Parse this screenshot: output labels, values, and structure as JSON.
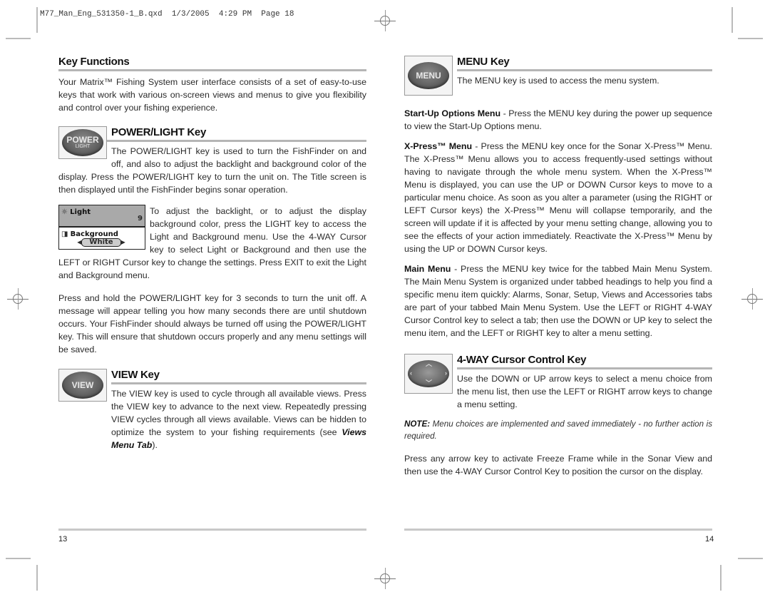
{
  "slug": "M77_Man_Eng_531350-1_B.qxd  1/3/2005  4:29 PM  Page 18",
  "left": {
    "key_functions": {
      "title": "Key Functions",
      "body": "Your Matrix™ Fishing System user interface consists of a set of easy-to-use keys that work with various on-screen views and menus to give you flexibility and control over your fishing experience."
    },
    "power_light": {
      "title": "POWER/LIGHT Key",
      "icon_label_top": "POWER",
      "icon_label_bottom": "LIGHT",
      "body": "The POWER/LIGHT key is used to turn the FishFinder on and off, and also to adjust the backlight and background color of the display. Press the POWER/LIGHT key to turn the unit on. The Title screen is then displayed until the FishFinder begins sonar operation.",
      "lcd": {
        "light_label": "Light",
        "light_value": "9",
        "background_label": "Background",
        "background_value": "White"
      },
      "adjust_body": "To adjust the backlight, or to adjust the display background color, press the LIGHT key to access the Light and Background menu. Use the 4-WAY Cursor key to select Light or Background and then use the LEFT or RIGHT Cursor key to change the settings. Press EXIT to exit the Light and Background menu.",
      "hold_body": "Press and hold the POWER/LIGHT key for 3 seconds to turn the unit off. A message will appear telling you how many seconds there are until shutdown occurs. Your FishFinder should always be turned off using the POWER/LIGHT key. This will ensure that shutdown occurs properly and any menu settings will be saved."
    },
    "view": {
      "title": "VIEW Key",
      "icon_label": "VIEW",
      "body": "The VIEW key is used to cycle through all available views. Press the VIEW key to advance to the next view. Repeatedly pressing VIEW cycles through all views available. Views can be hidden to optimize the system to your fishing requirements (see ",
      "link": "Views Menu Tab",
      "body_end": ")."
    },
    "page_number": "13"
  },
  "right": {
    "menu": {
      "title": "MENU Key",
      "icon_label": "MENU",
      "body": "The MENU key is used to access the menu system."
    },
    "startup": {
      "term": "Start-Up Options Menu",
      "body": " - Press the MENU key during the power up sequence to view the Start-Up Options menu."
    },
    "xpress": {
      "term": "X-Press™ Menu",
      "body": " - Press the MENU key once for the Sonar X-Press™ Menu. The X-Press™ Menu allows you to access frequently-used settings without having to navigate through the whole menu system. When the X-Press™ Menu is displayed, you can use the UP or DOWN Cursor keys to move to a particular menu choice. As soon as you alter a parameter (using the RIGHT or LEFT Cursor keys) the X-Press™ Menu will collapse temporarily, and the screen will update if it is affected by your menu setting change, allowing you to see the effects of your action immediately. Reactivate the X-Press™ Menu by using the UP or DOWN Cursor keys."
    },
    "main_menu": {
      "term": "Main Menu",
      "body": " - Press the MENU key twice for the tabbed Main Menu System. The Main Menu System is organized under tabbed headings to help you find a specific menu item quickly: Alarms, Sonar, Setup, Views and Accessories tabs are part of your tabbed Main Menu System. Use the LEFT or RIGHT 4-WAY Cursor Control key to select a tab; then use the DOWN or UP key to select the menu item, and the LEFT or RIGHT key to alter a menu setting."
    },
    "cursor": {
      "title": "4-WAY Cursor Control Key",
      "body": "Use the DOWN or UP arrow keys to select a menu choice from the menu list, then use the LEFT or RIGHT arrow keys to change a menu setting."
    },
    "note": {
      "label": "NOTE:",
      "body": " Menu choices are implemented and saved immediately - no further action is required."
    },
    "freeze": {
      "body": "Press any arrow key to activate Freeze Frame while in the Sonar View and then use the 4-WAY Cursor Control Key to position the cursor on the display."
    },
    "page_number": "14"
  }
}
